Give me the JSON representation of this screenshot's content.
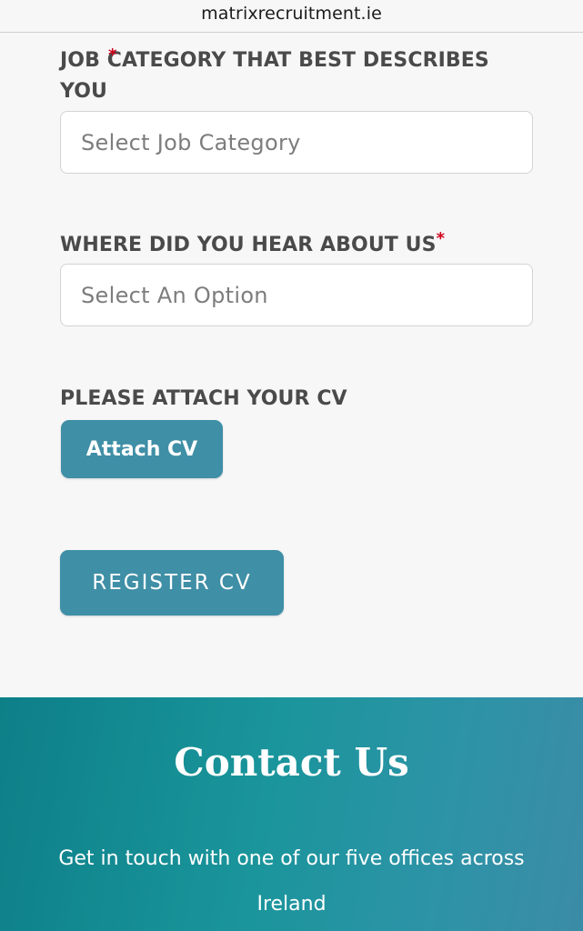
{
  "browser": {
    "url": "matrixrecruitment.ie"
  },
  "form": {
    "job_category": {
      "label": "JOB CATEGORY THAT BEST DESCRIBES YOU",
      "required_mark": "*",
      "placeholder": "Select Job Category"
    },
    "hear_about": {
      "label": "WHERE DID YOU HEAR ABOUT US",
      "required_mark": "*",
      "placeholder": "Select An Option"
    },
    "attach": {
      "label": "PLEASE ATTACH YOUR CV",
      "button_label": "Attach CV"
    },
    "register_button_label": "REGISTER CV"
  },
  "contact": {
    "title": "Contact Us",
    "description": "Get in touch with one of our five offices across Ireland"
  },
  "colors": {
    "button": "#3f8fa6",
    "required": "#d0021b",
    "contact_gradient_start": "#0d7f88",
    "contact_gradient_end": "#3b8ca6"
  }
}
